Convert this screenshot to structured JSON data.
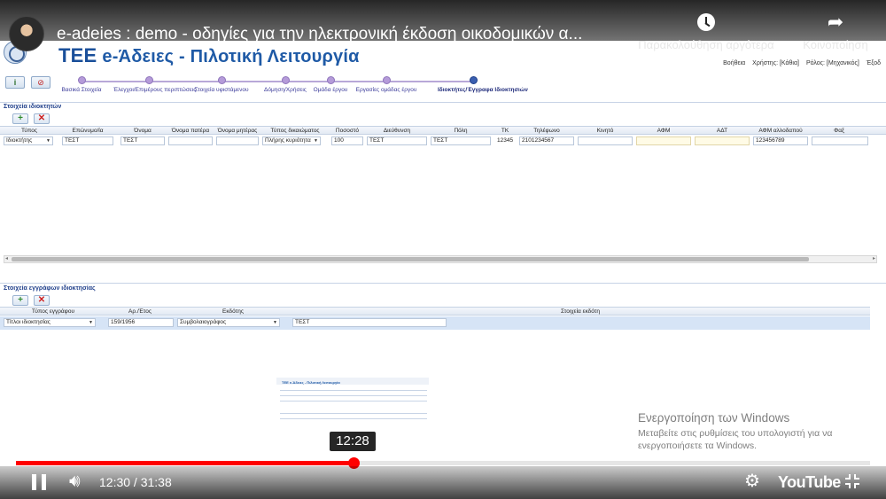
{
  "youtube": {
    "video_title": "e-adeies : demo - οδηγίες για την ηλεκτρονική έκδοση οικοδομικών α...",
    "watch_later_label": "Παρακολούθηση αργότερα",
    "share_label": "Κοινοποίηση",
    "current_time": "12:30",
    "duration": "31:38",
    "time_display": "12:30 / 31:38",
    "hover_time": "12:28",
    "progress_played": 0.395,
    "progress_buffered": 0.458,
    "logo_text": "YouTube",
    "colors": {
      "progress": "#ff0000"
    }
  },
  "windows_watermark": {
    "title": "Ενεργοποίηση των Windows",
    "subtitle": "Μεταβείτε στις ρυθμίσεις του υπολογιστή για να ενεργοποιήσετε τα Windows."
  },
  "app": {
    "brand": "ΤΕΕ",
    "title": "e-Άδειες  - Πιλοτική Λειτουργία",
    "user_info": {
      "help": "Βοήθεια",
      "user": "Χρήστης: [Κάθια]",
      "role": "Ρόλος: [Μηχανικός]",
      "exit": "Έξοδ"
    },
    "toolbar": {
      "info_glyph": "i",
      "cancel_glyph": "⊘"
    },
    "wizard_steps": [
      {
        "label": "Βασικά Στοιχεία",
        "active": false
      },
      {
        "label": "Έλεγχοι/Επιμέρους περιπτώσεις",
        "active": false
      },
      {
        "label": "Στοιχεία υφιστάμενου",
        "active": false
      },
      {
        "label": "Δόμηση/Χρήσεις",
        "active": false
      },
      {
        "label": "Ομάδα έργου",
        "active": false
      },
      {
        "label": "Εργασίες ομάδας έργου",
        "active": false
      },
      {
        "label": "Ιδιοκτήτες/Έγγραφα Ιδιοκτησιών",
        "active": true
      }
    ],
    "owners_section": {
      "title": "Στοιχεία ιδιοκτητών",
      "add_glyph": "+",
      "delete_glyph": "✕",
      "columns": [
        "Τύπος",
        "Επώνυμο/ία",
        "Όνομα",
        "Όνομα πατέρα",
        "Όνομα μητέρας",
        "Τύπος δικαιώματος",
        "Ποσοστό",
        "Διεύθυνση",
        "Πόλη",
        "ΤΚ",
        "Τηλέφωνο",
        "Κινητό",
        "ΑΦΜ",
        "ΑΔΤ",
        "ΑΦΜ αλλοδαπού",
        "Φαξ"
      ],
      "row": {
        "type": "Ιδιοκτήτης",
        "surname": "ΤΕΣΤ",
        "name": "ΤΕΣΤ",
        "father_name": "",
        "mother_name": "",
        "right_type": "Πλήρης κυριότητα",
        "percent": "100",
        "address": "ΤΕΣΤ",
        "city": "ΤΕΣΤ",
        "postal_code": "12345",
        "phone": "2101234567",
        "mobile": "",
        "afm": "",
        "adt": "",
        "foreign_afm": "123456789",
        "fax": ""
      }
    },
    "documents_section": {
      "title": "Στοιχεία εγγράφων ιδιοκτησίας",
      "add_glyph": "+",
      "delete_glyph": "✕",
      "columns": [
        "Τύπος εγγράφου",
        "Αρ./Έτος",
        "Εκδότης",
        "Στοιχεία εκδότη"
      ],
      "row": {
        "doc_type": "Τίτλοι ιδιοκτησίας",
        "number_year": "159/1956",
        "issuer": "Συμβολαιογράφος",
        "issuer_details": "ΤΕΣΤ"
      }
    },
    "thumbnail_title": "ΤΕΕ e-Άδειες - Πιλοτική Λειτουργία"
  }
}
